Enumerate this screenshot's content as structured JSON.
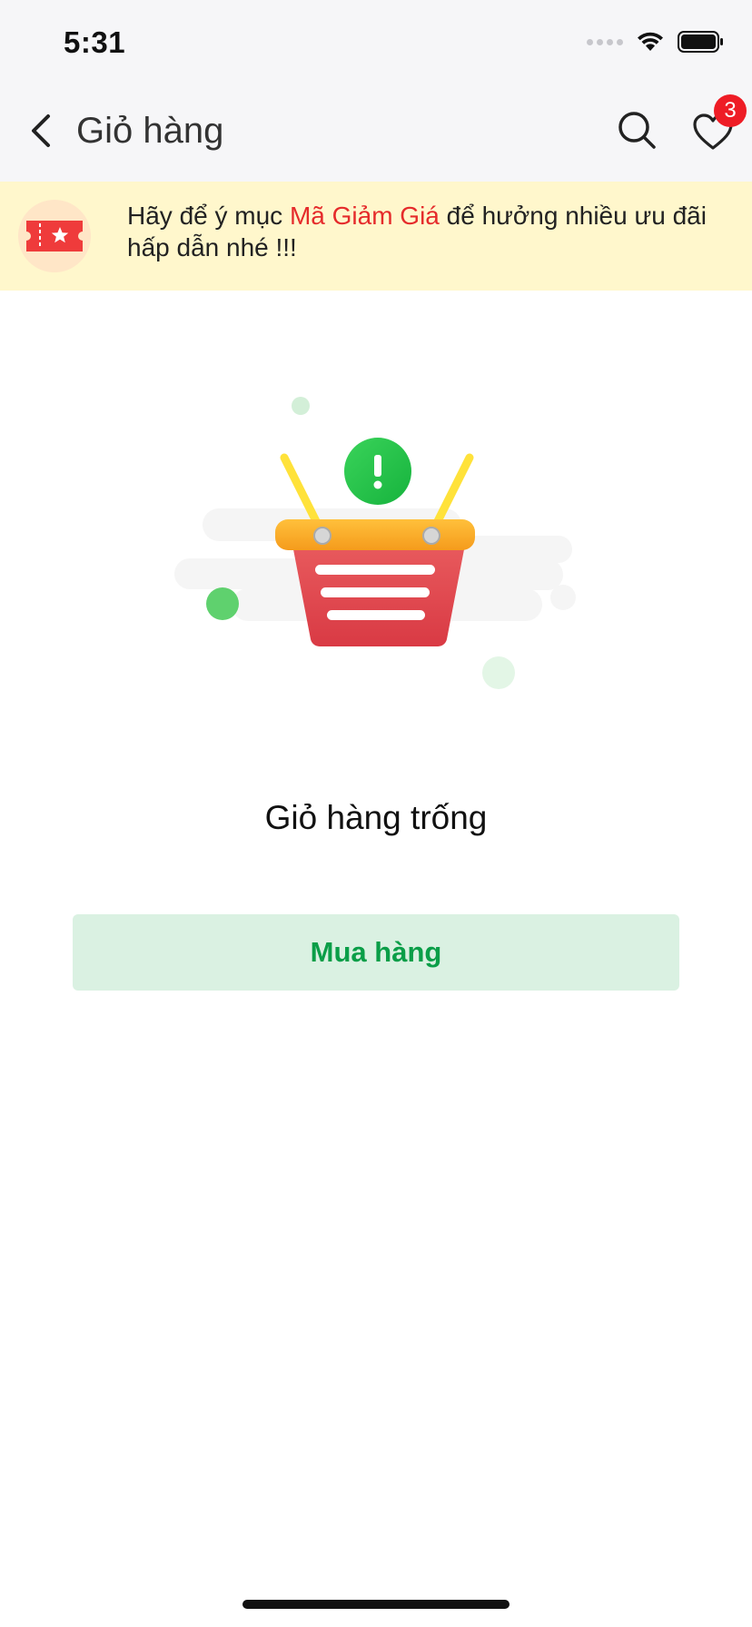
{
  "status_bar": {
    "time": "5:31"
  },
  "nav": {
    "title": "Giỏ hàng",
    "favorites_count": "3"
  },
  "banner": {
    "text_before": "Hãy để ý mục ",
    "highlight": "Mã Giảm Giá",
    "text_after": " để hưởng nhiều ưu đãi hấp dẫn nhé !!!"
  },
  "empty_state": {
    "title": "Giỏ hàng trống",
    "button_label": "Mua hàng"
  },
  "icons": {
    "back": "chevron-left-icon",
    "search": "search-icon",
    "favorites": "heart-icon",
    "coupon": "coupon-ticket-icon",
    "illustration": "empty-basket-illustration"
  },
  "colors": {
    "accent_green": "#0a9e48",
    "button_bg": "#daf1e2",
    "badge_red": "#ee1c25",
    "highlight_red": "#e52b2b",
    "banner_bg": "#fff7cc"
  }
}
